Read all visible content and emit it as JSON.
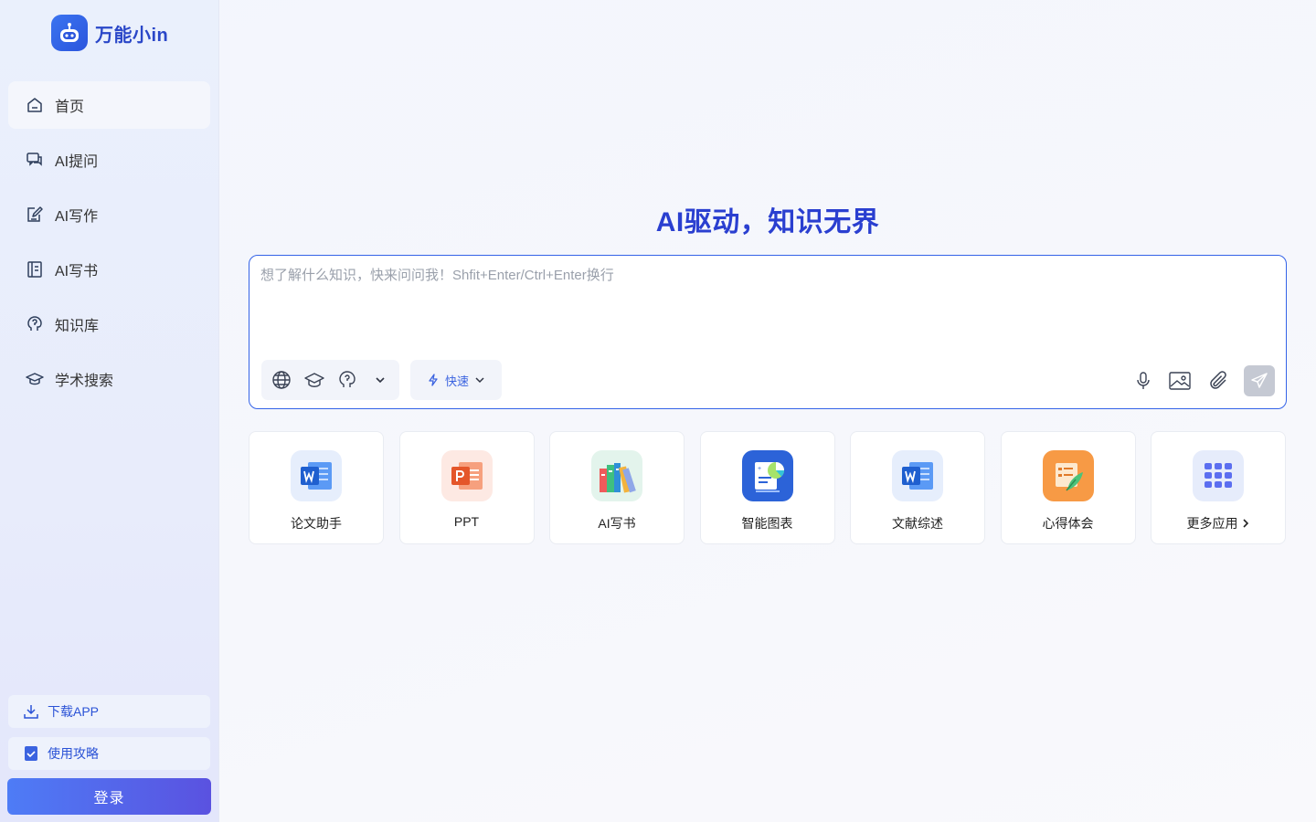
{
  "app": {
    "name": "万能小in",
    "brand_color": "#2a47c8"
  },
  "sidebar": {
    "items": [
      {
        "label": "首页",
        "icon": "home-icon",
        "active": true
      },
      {
        "label": "AI提问",
        "icon": "chat-icon",
        "active": false
      },
      {
        "label": "AI写作",
        "icon": "edit-icon",
        "active": false
      },
      {
        "label": "AI写书",
        "icon": "book-icon",
        "active": false
      },
      {
        "label": "知识库",
        "icon": "brain-icon",
        "active": false
      },
      {
        "label": "学术搜索",
        "icon": "graduation-cap-icon",
        "active": false
      }
    ],
    "download_label": "下载APP",
    "guide_label": "使用攻略",
    "login_label": "登录"
  },
  "main": {
    "headline": "AI驱动，知识无界",
    "input_placeholder": "想了解什么知识，快来问问我！Shfit+Enter/Ctrl+Enter换行",
    "mode_label": "快速",
    "accent_color": "#3463e8"
  },
  "cards": [
    {
      "label": "论文助手",
      "icon": "word-doc-icon"
    },
    {
      "label": "PPT",
      "icon": "powerpoint-icon"
    },
    {
      "label": "AI写书",
      "icon": "books-icon"
    },
    {
      "label": "智能图表",
      "icon": "chart-report-icon"
    },
    {
      "label": "文献综述",
      "icon": "word-doc-icon"
    },
    {
      "label": "心得体会",
      "icon": "notes-feather-icon"
    },
    {
      "label": "更多应用",
      "icon": "app-grid-icon"
    }
  ]
}
